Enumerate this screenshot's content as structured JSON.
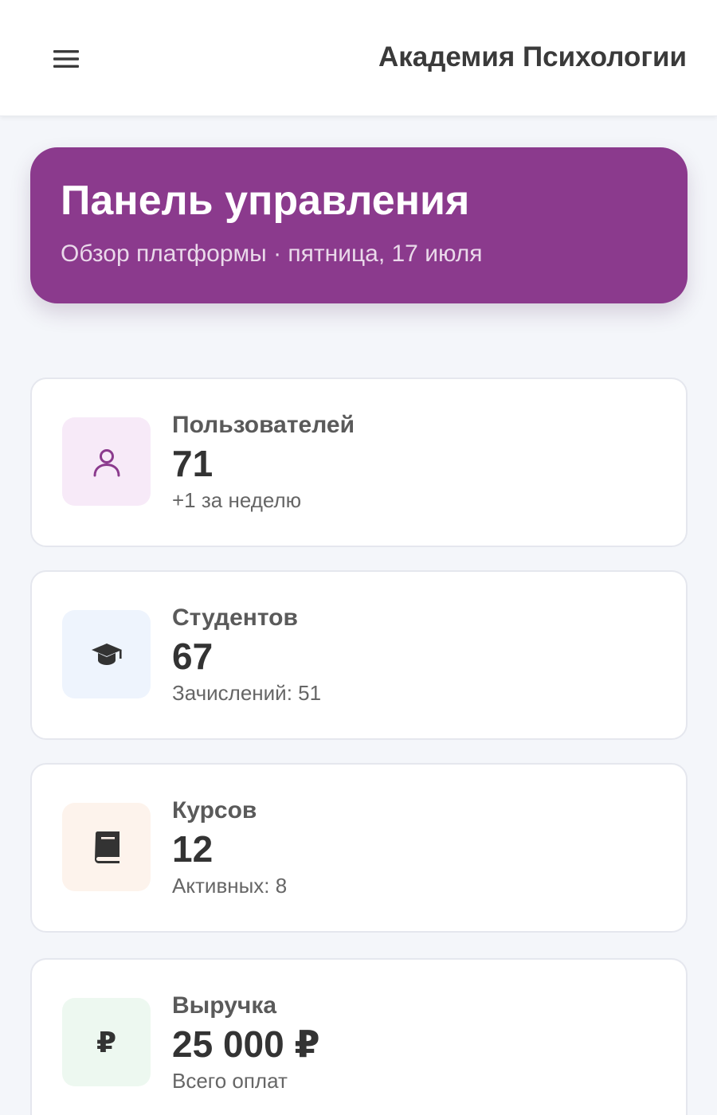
{
  "header": {
    "menu_icon": "hamburger-menu-icon",
    "app_title": "Академия Психологии"
  },
  "hero": {
    "title": "Панель управления",
    "subtitle": "Обзор платформы · пятница, 17 июля",
    "background_color": "#8b3a8d"
  },
  "stats": [
    {
      "label": "Пользователей",
      "value": "71",
      "note": "+1 за неделю",
      "icon": "user-icon",
      "icon_color": "#8b3a8d",
      "icon_bg": "#f7eaf8"
    },
    {
      "label": "Студентов",
      "value": "67",
      "note": "Зачислений: 51",
      "icon": "graduation-cap-icon",
      "icon_color": "#333333",
      "icon_bg": "#eef4fd"
    },
    {
      "label": "Курсов",
      "value": "12",
      "note": "Активных: 8",
      "icon": "book-icon",
      "icon_color": "#333333",
      "icon_bg": "#fdf3ec"
    },
    {
      "label": "Выручка",
      "value": "25 000 ₽",
      "note": "Всего оплат",
      "icon": "ruble-icon",
      "icon_glyph": "₽",
      "icon_color": "#333333",
      "icon_bg": "#edf8f0"
    }
  ]
}
